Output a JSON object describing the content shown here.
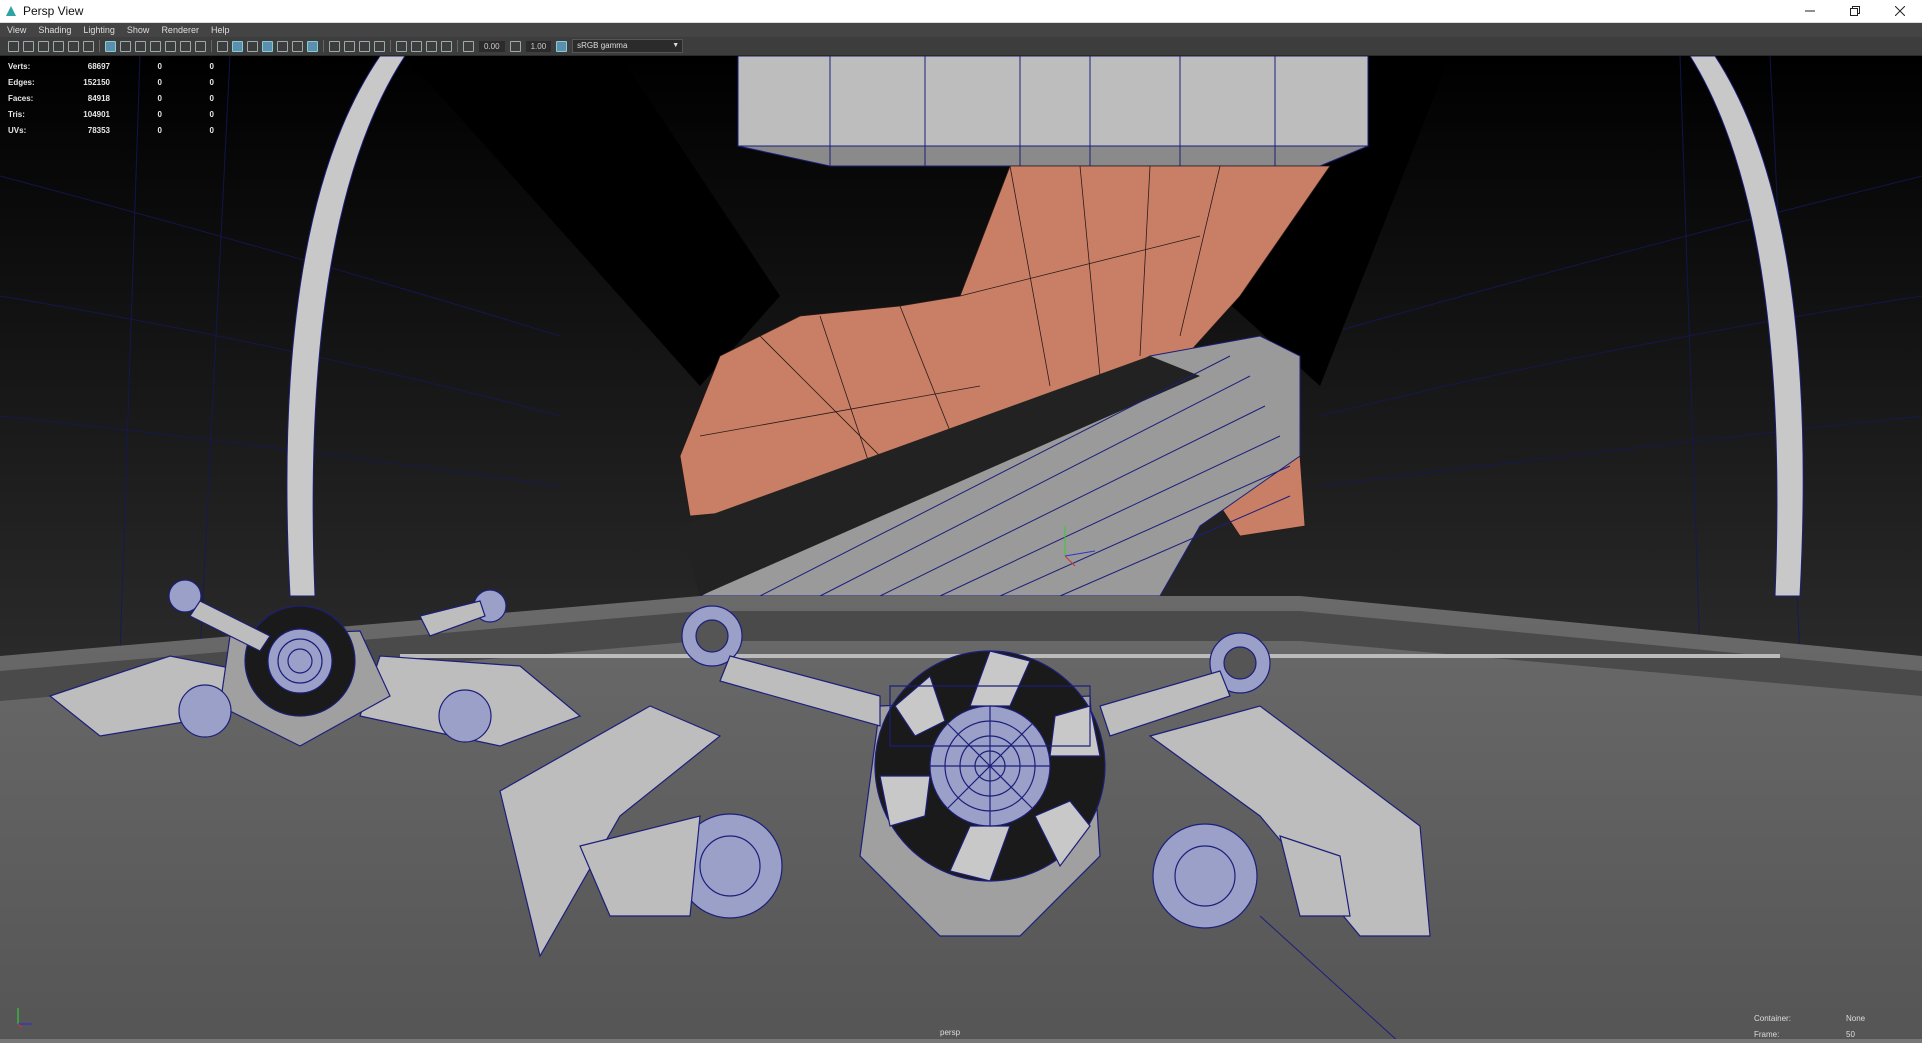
{
  "window": {
    "title": "Persp View"
  },
  "menu": {
    "items": [
      "View",
      "Shading",
      "Lighting",
      "Show",
      "Renderer",
      "Help"
    ]
  },
  "toolbar": {
    "exposure": "0.00",
    "gamma": "1.00",
    "color_space": "sRGB gamma"
  },
  "hud": {
    "rows": [
      {
        "label": "Verts:",
        "values": [
          "68697",
          "0",
          "0"
        ]
      },
      {
        "label": "Edges:",
        "values": [
          "152150",
          "0",
          "0"
        ]
      },
      {
        "label": "Faces:",
        "values": [
          "84918",
          "0",
          "0"
        ]
      },
      {
        "label": "Tris:",
        "values": [
          "104901",
          "0",
          "0"
        ]
      },
      {
        "label": "UVs:",
        "values": [
          "78353",
          "0",
          "0"
        ]
      }
    ],
    "camera": "persp",
    "container_label": "Container:",
    "container_value": "None",
    "frame_label": "Frame:",
    "frame_value": "50"
  },
  "colors": {
    "accent": "#5a8fb0",
    "wireframe": "#1c1f7a",
    "terrain": "#c97f66",
    "viewport_bg": "#5e5e5e"
  }
}
